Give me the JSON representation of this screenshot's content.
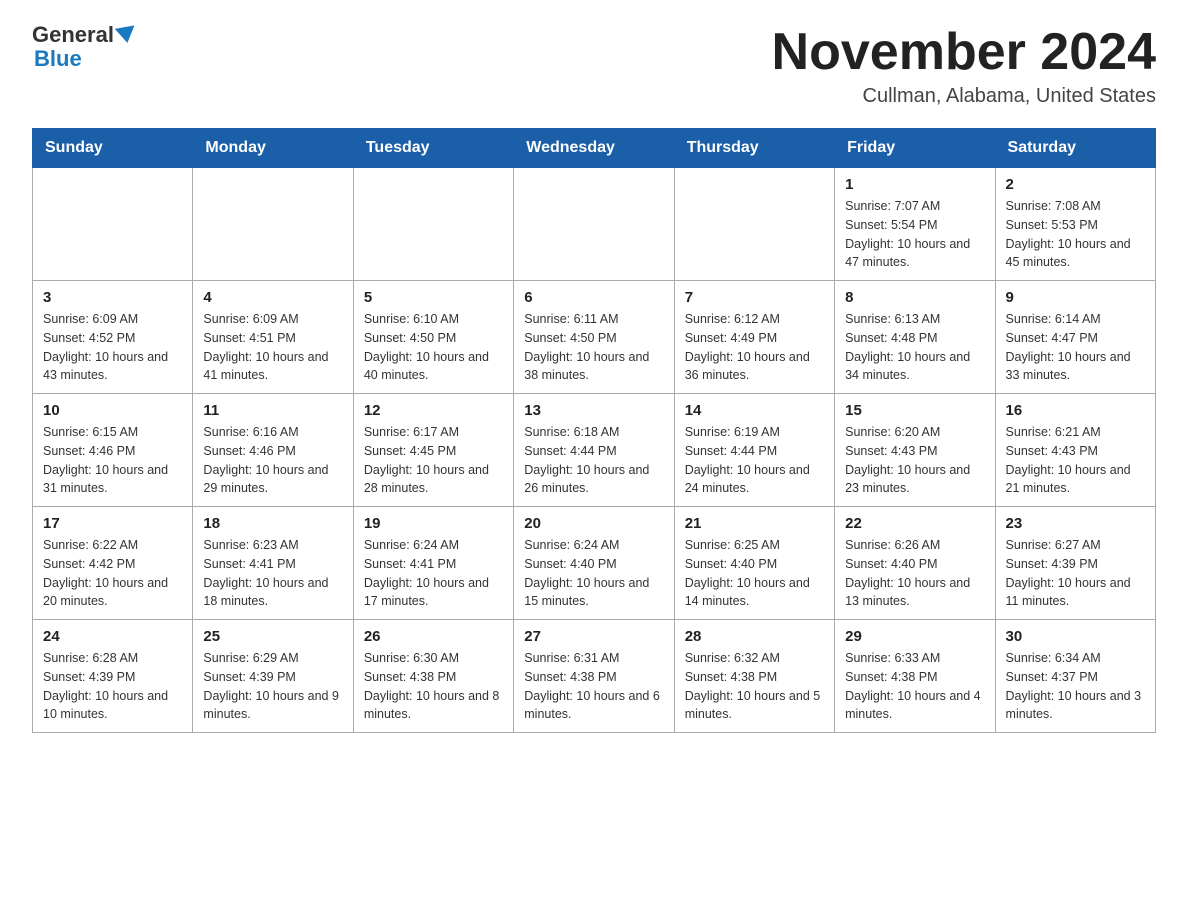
{
  "header": {
    "logo_general": "General",
    "logo_blue": "Blue",
    "month_title": "November 2024",
    "location": "Cullman, Alabama, United States"
  },
  "weekdays": [
    "Sunday",
    "Monday",
    "Tuesday",
    "Wednesday",
    "Thursday",
    "Friday",
    "Saturday"
  ],
  "weeks": [
    [
      {
        "day": "",
        "info": ""
      },
      {
        "day": "",
        "info": ""
      },
      {
        "day": "",
        "info": ""
      },
      {
        "day": "",
        "info": ""
      },
      {
        "day": "",
        "info": ""
      },
      {
        "day": "1",
        "info": "Sunrise: 7:07 AM\nSunset: 5:54 PM\nDaylight: 10 hours and 47 minutes."
      },
      {
        "day": "2",
        "info": "Sunrise: 7:08 AM\nSunset: 5:53 PM\nDaylight: 10 hours and 45 minutes."
      }
    ],
    [
      {
        "day": "3",
        "info": "Sunrise: 6:09 AM\nSunset: 4:52 PM\nDaylight: 10 hours and 43 minutes."
      },
      {
        "day": "4",
        "info": "Sunrise: 6:09 AM\nSunset: 4:51 PM\nDaylight: 10 hours and 41 minutes."
      },
      {
        "day": "5",
        "info": "Sunrise: 6:10 AM\nSunset: 4:50 PM\nDaylight: 10 hours and 40 minutes."
      },
      {
        "day": "6",
        "info": "Sunrise: 6:11 AM\nSunset: 4:50 PM\nDaylight: 10 hours and 38 minutes."
      },
      {
        "day": "7",
        "info": "Sunrise: 6:12 AM\nSunset: 4:49 PM\nDaylight: 10 hours and 36 minutes."
      },
      {
        "day": "8",
        "info": "Sunrise: 6:13 AM\nSunset: 4:48 PM\nDaylight: 10 hours and 34 minutes."
      },
      {
        "day": "9",
        "info": "Sunrise: 6:14 AM\nSunset: 4:47 PM\nDaylight: 10 hours and 33 minutes."
      }
    ],
    [
      {
        "day": "10",
        "info": "Sunrise: 6:15 AM\nSunset: 4:46 PM\nDaylight: 10 hours and 31 minutes."
      },
      {
        "day": "11",
        "info": "Sunrise: 6:16 AM\nSunset: 4:46 PM\nDaylight: 10 hours and 29 minutes."
      },
      {
        "day": "12",
        "info": "Sunrise: 6:17 AM\nSunset: 4:45 PM\nDaylight: 10 hours and 28 minutes."
      },
      {
        "day": "13",
        "info": "Sunrise: 6:18 AM\nSunset: 4:44 PM\nDaylight: 10 hours and 26 minutes."
      },
      {
        "day": "14",
        "info": "Sunrise: 6:19 AM\nSunset: 4:44 PM\nDaylight: 10 hours and 24 minutes."
      },
      {
        "day": "15",
        "info": "Sunrise: 6:20 AM\nSunset: 4:43 PM\nDaylight: 10 hours and 23 minutes."
      },
      {
        "day": "16",
        "info": "Sunrise: 6:21 AM\nSunset: 4:43 PM\nDaylight: 10 hours and 21 minutes."
      }
    ],
    [
      {
        "day": "17",
        "info": "Sunrise: 6:22 AM\nSunset: 4:42 PM\nDaylight: 10 hours and 20 minutes."
      },
      {
        "day": "18",
        "info": "Sunrise: 6:23 AM\nSunset: 4:41 PM\nDaylight: 10 hours and 18 minutes."
      },
      {
        "day": "19",
        "info": "Sunrise: 6:24 AM\nSunset: 4:41 PM\nDaylight: 10 hours and 17 minutes."
      },
      {
        "day": "20",
        "info": "Sunrise: 6:24 AM\nSunset: 4:40 PM\nDaylight: 10 hours and 15 minutes."
      },
      {
        "day": "21",
        "info": "Sunrise: 6:25 AM\nSunset: 4:40 PM\nDaylight: 10 hours and 14 minutes."
      },
      {
        "day": "22",
        "info": "Sunrise: 6:26 AM\nSunset: 4:40 PM\nDaylight: 10 hours and 13 minutes."
      },
      {
        "day": "23",
        "info": "Sunrise: 6:27 AM\nSunset: 4:39 PM\nDaylight: 10 hours and 11 minutes."
      }
    ],
    [
      {
        "day": "24",
        "info": "Sunrise: 6:28 AM\nSunset: 4:39 PM\nDaylight: 10 hours and 10 minutes."
      },
      {
        "day": "25",
        "info": "Sunrise: 6:29 AM\nSunset: 4:39 PM\nDaylight: 10 hours and 9 minutes."
      },
      {
        "day": "26",
        "info": "Sunrise: 6:30 AM\nSunset: 4:38 PM\nDaylight: 10 hours and 8 minutes."
      },
      {
        "day": "27",
        "info": "Sunrise: 6:31 AM\nSunset: 4:38 PM\nDaylight: 10 hours and 6 minutes."
      },
      {
        "day": "28",
        "info": "Sunrise: 6:32 AM\nSunset: 4:38 PM\nDaylight: 10 hours and 5 minutes."
      },
      {
        "day": "29",
        "info": "Sunrise: 6:33 AM\nSunset: 4:38 PM\nDaylight: 10 hours and 4 minutes."
      },
      {
        "day": "30",
        "info": "Sunrise: 6:34 AM\nSunset: 4:37 PM\nDaylight: 10 hours and 3 minutes."
      }
    ]
  ]
}
